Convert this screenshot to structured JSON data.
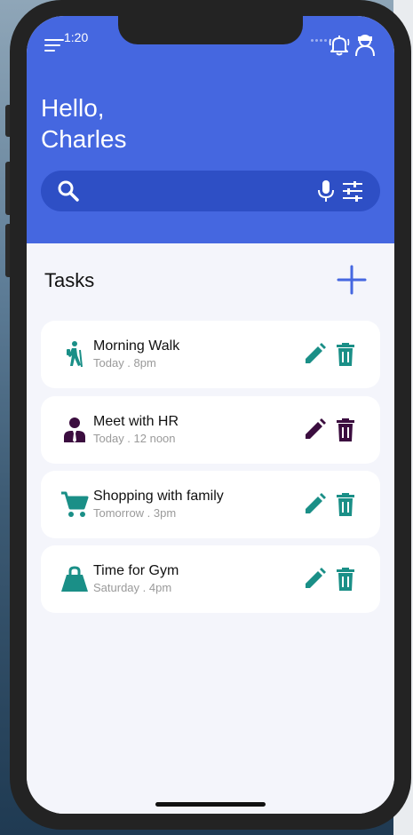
{
  "status": {
    "time": "1:20"
  },
  "header": {
    "greeting_line1": "Hello,",
    "greeting_line2": "Charles",
    "search_placeholder": "",
    "bg_color": "#4567e0"
  },
  "tasks": {
    "title": "Tasks",
    "items": [
      {
        "title": "Morning Walk",
        "subtitle": "Today . 8pm",
        "icon": "hiking-icon",
        "color": "#1a8f87"
      },
      {
        "title": "Meet with HR",
        "subtitle": "Today . 12 noon",
        "icon": "person-suit-icon",
        "color": "#3b0d3f"
      },
      {
        "title": "Shopping with family",
        "subtitle": "Tomorrow . 3pm",
        "icon": "cart-icon",
        "color": "#1a8f87"
      },
      {
        "title": "Time for Gym",
        "subtitle": "Saturday . 4pm",
        "icon": "kettlebell-icon",
        "color": "#1a8f87"
      }
    ]
  }
}
